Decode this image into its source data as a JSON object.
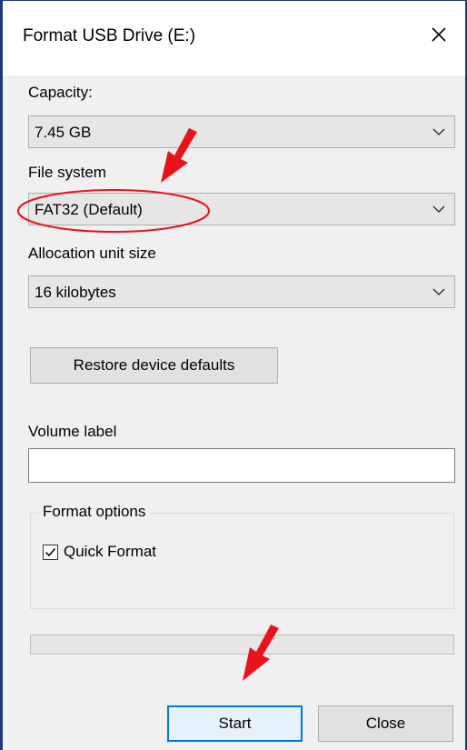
{
  "window": {
    "title": "Format USB Drive (E:)",
    "close_glyph": "✕"
  },
  "capacity": {
    "label": "Capacity:",
    "value": "7.45 GB"
  },
  "file_system": {
    "label": "File system",
    "value": "FAT32 (Default)"
  },
  "allocation": {
    "label": "Allocation unit size",
    "value": "16 kilobytes"
  },
  "restore_button": {
    "label": "Restore device defaults"
  },
  "volume_label": {
    "label": "Volume label",
    "value": ""
  },
  "format_options": {
    "legend": "Format options",
    "quick_format": {
      "label": "Quick Format",
      "checked": true
    }
  },
  "progress": {
    "fraction": 0
  },
  "buttons": {
    "start": "Start",
    "close": "Close"
  },
  "colors": {
    "annotation": "#e8141c",
    "focus_border": "#0078d7",
    "window_border": "#1f3a73",
    "dialog_bg": "#f0f0f0"
  },
  "icons": {
    "close": "close-icon",
    "dropdown": "chevron-down-icon",
    "check": "checkmark-icon",
    "annotation": "red-arrow-icon"
  }
}
